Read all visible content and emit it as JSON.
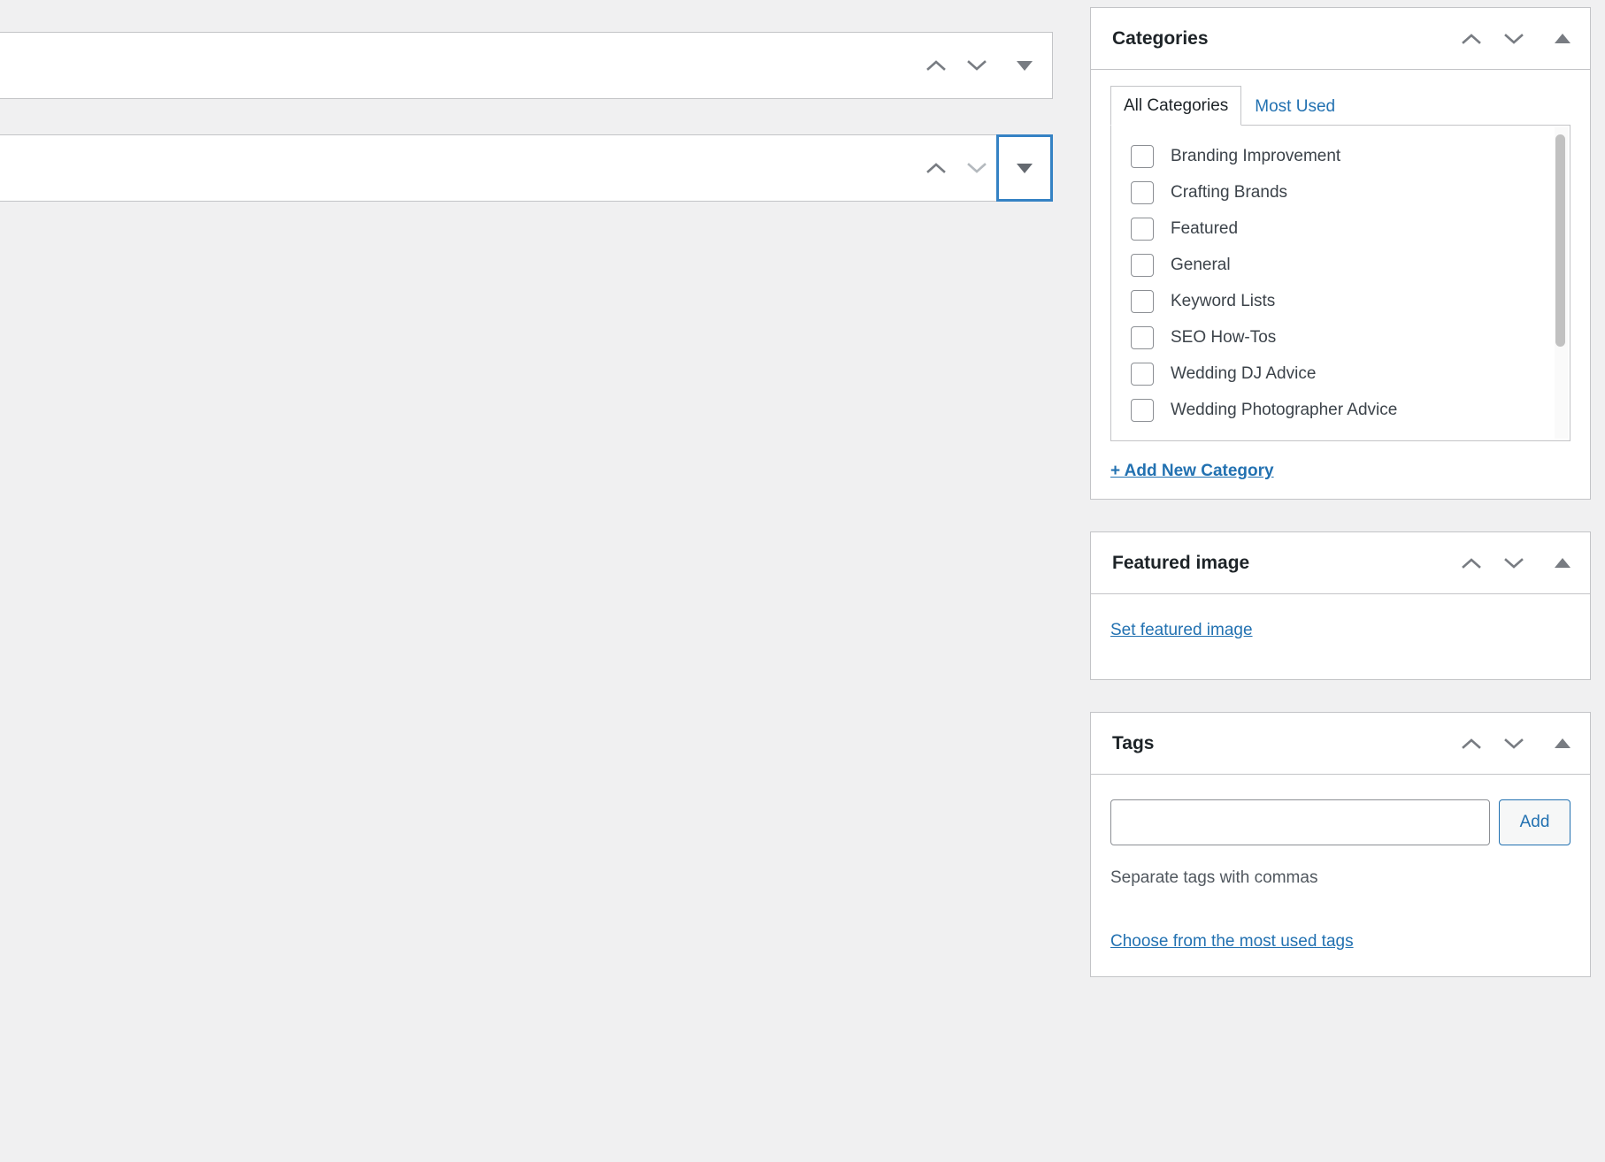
{
  "main": {
    "metaboxes": [
      {
        "move_up_label": "Move up",
        "move_down_label": "Move down",
        "toggle_label": "Toggle panel",
        "focused": false,
        "down_dim": false
      },
      {
        "move_up_label": "Move up",
        "move_down_label": "Move down",
        "toggle_label": "Toggle panel",
        "focused": true,
        "down_dim": true
      }
    ]
  },
  "sidebar": {
    "categories_panel": {
      "title": "Categories",
      "move_up_label": "Move up",
      "move_down_label": "Move down",
      "toggle_label": "Toggle panel",
      "tabs": [
        {
          "label": "All Categories",
          "active": true
        },
        {
          "label": "Most Used",
          "active": false
        }
      ],
      "items": [
        {
          "label": "Branding Improvement",
          "checked": false
        },
        {
          "label": "Crafting Brands",
          "checked": false
        },
        {
          "label": "Featured",
          "checked": false
        },
        {
          "label": "General",
          "checked": false
        },
        {
          "label": "Keyword Lists",
          "checked": false
        },
        {
          "label": "SEO How-Tos",
          "checked": false
        },
        {
          "label": "Wedding DJ Advice",
          "checked": false
        },
        {
          "label": "Wedding Photographer Advice",
          "checked": false
        }
      ],
      "add_new_label": "+ Add New Category"
    },
    "featured_image_panel": {
      "title": "Featured image",
      "move_up_label": "Move up",
      "move_down_label": "Move down",
      "toggle_label": "Toggle panel",
      "set_link_label": "Set featured image"
    },
    "tags_panel": {
      "title": "Tags",
      "move_up_label": "Move up",
      "move_down_label": "Move down",
      "toggle_label": "Toggle panel",
      "input_value": "",
      "input_placeholder": "",
      "add_button_label": "Add",
      "hint": "Separate tags with commas",
      "most_used_link_label": "Choose from the most used tags"
    }
  },
  "colors": {
    "link": "#2271b1",
    "focus_outline": "#3582c4",
    "panel_border": "#c3c4c7",
    "page_bg": "#f0f0f1"
  }
}
